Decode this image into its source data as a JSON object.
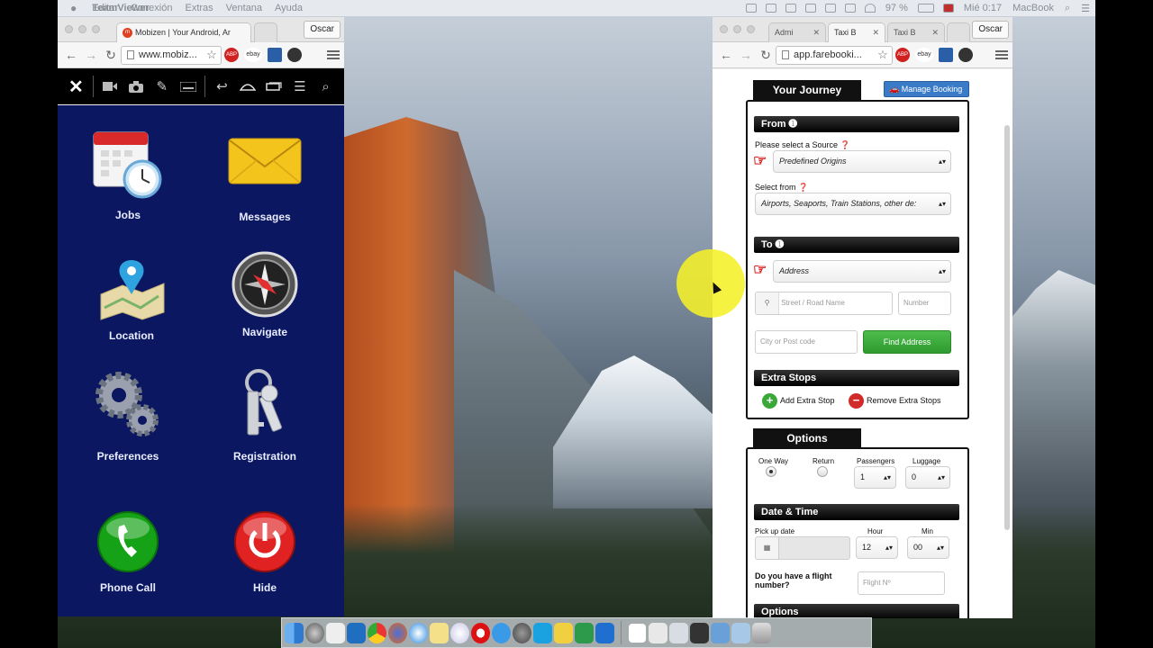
{
  "menubar": {
    "apple": "",
    "app_name": "TeamViewer",
    "items": [
      "Editar",
      "Conexión",
      "Extras",
      "Ventana",
      "Ayuda"
    ],
    "battery": "97 %",
    "clock": "Mié 0:17",
    "computer_name": "MacBook"
  },
  "left_browser": {
    "tab_active": "Mobizen | Your Android, Ar",
    "user": "Oscar",
    "url": "www.mobiz...",
    "favicon": "m"
  },
  "mobizen_toolbar": {
    "icons": [
      "close-icon",
      "video-icon",
      "camera-icon",
      "pen-icon",
      "keyboard-icon",
      "back-icon",
      "home-icon",
      "recent-apps-icon",
      "menu-icon",
      "search-icon"
    ]
  },
  "phone_apps": [
    {
      "label": "Jobs",
      "icon": "calendar-clock-icon"
    },
    {
      "label": "Messages",
      "icon": "envelope-icon"
    },
    {
      "label": "Location",
      "icon": "map-pin-icon"
    },
    {
      "label": "Navigate",
      "icon": "compass-icon"
    },
    {
      "label": "Preferences",
      "icon": "gears-icon"
    },
    {
      "label": "Registration",
      "icon": "keys-icon"
    },
    {
      "label": "Phone Call",
      "icon": "phone-icon"
    },
    {
      "label": "Hide",
      "icon": "power-icon"
    }
  ],
  "right_browser": {
    "tabs": [
      "Admi",
      "Taxi B",
      "Taxi B"
    ],
    "user": "Oscar",
    "url": "app.farebooki..."
  },
  "booking": {
    "your_journey": "Your Journey",
    "manage_booking": "Manage Booking",
    "from": {
      "header": "From",
      "source_label": "Please select a Source",
      "source_value": "Predefined Origins",
      "select_from_label": "Select from",
      "select_from_value": "Airports, Seaports, Train Stations, other de:"
    },
    "to": {
      "header": "To",
      "type_value": "Address",
      "street_placeholder": "Street / Road Name",
      "number_placeholder": "Number",
      "city_placeholder": "City or Post code",
      "find_button": "Find Address"
    },
    "extra_stops": {
      "header": "Extra Stops",
      "add": "Add Extra Stop",
      "remove": "Remove Extra Stops"
    },
    "options_tab": "Options",
    "options": {
      "one_way": "One Way",
      "return": "Return",
      "passengers_label": "Passengers",
      "passengers_value": "1",
      "luggage_label": "Luggage",
      "luggage_value": "0"
    },
    "datetime": {
      "header": "Date & Time",
      "pickup_label": "Pick up date",
      "hour_label": "Hour",
      "hour_value": "12",
      "min_label": "Min",
      "min_value": "00",
      "flight_question": "Do you have a flight number?",
      "flight_placeholder": "Flight Nº"
    },
    "options_header2": "Options"
  },
  "dock_apps": [
    "finder",
    "launchpad",
    "photos",
    "outlook",
    "chrome",
    "firefox",
    "safari",
    "notes",
    "itunes",
    "opera",
    "app-store",
    "system-preferences",
    "skype",
    "sticky",
    "camtasia",
    "teamviewer",
    "document",
    "mail",
    "preview",
    "calculator",
    "screen",
    "folder",
    "trash"
  ],
  "colors": {
    "phone_bg": "#0b1760",
    "find_button": "#3aa83a",
    "manage_booking": "#3a7bc8",
    "cursor_highlight": "#f5f028"
  }
}
